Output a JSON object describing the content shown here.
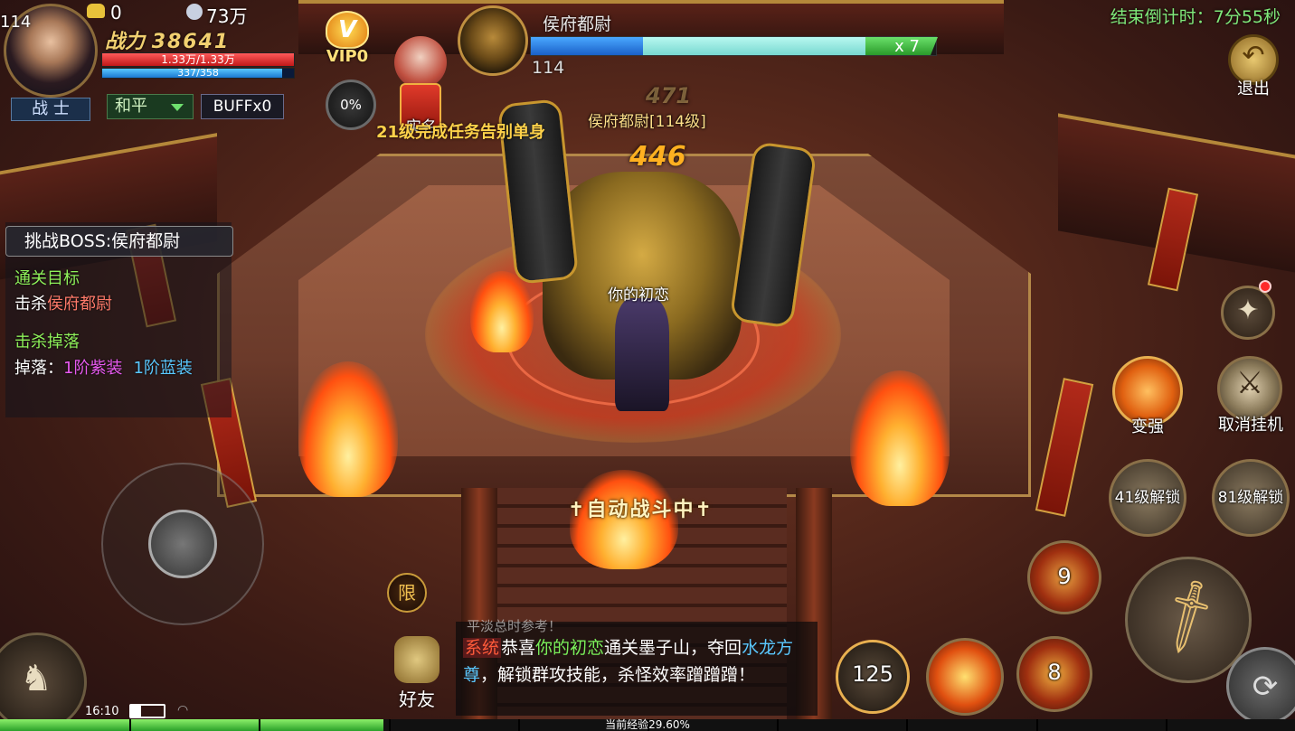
{
  "player": {
    "level": "114",
    "gold_ingot": "0",
    "silver": "73万",
    "power_label": "战力",
    "power_value": "38641",
    "hp_text": "1.33万/1.33万",
    "mp_text": "337/358",
    "class": "战 士",
    "pk_mode": "和平",
    "buff": "BUFFx0",
    "percent": "0%",
    "vip": "VIP0"
  },
  "realname": {
    "label": "实名"
  },
  "quest_marquee": "21级完成任务告别单身",
  "boss": {
    "name": "侯府都尉",
    "level": "114",
    "hp_multiplier": "x 7",
    "overhead_name": "侯府都尉[114级]",
    "damage_faded": "471",
    "damage": "446"
  },
  "hero_name": "你的初恋",
  "timer": "结束倒计时：7分55秒",
  "exit": {
    "label": "退出"
  },
  "quest_panel": {
    "title": "挑战BOSS:侯府都尉",
    "goal_header": "通关目标",
    "goal_prefix": "击杀",
    "goal_target": "侯府都尉",
    "drop_header": "击杀掉落",
    "drop_prefix": "掉落：",
    "drop_purple": "1阶紫装",
    "drop_blue": "1阶蓝装"
  },
  "auto_fight": "自动战斗中",
  "right_buttons": {
    "strengthen": "变强",
    "cancel_afk": "取消挂机",
    "unlock_41": "41级解锁",
    "unlock_81": "81级解锁",
    "skill_cd_1": "9",
    "skill_cd_2": "8",
    "skill_center": "125"
  },
  "limit_label": "限",
  "friend_label": "好友",
  "chat": {
    "faded_top": "平淡总时参考！",
    "tag": "系统",
    "before": "恭喜",
    "player": "你的初恋",
    "middle": "通关墨子山，夺回",
    "item": "水龙方尊",
    "after": "，解锁群攻技能，杀怪效率蹭蹭蹭！"
  },
  "status": {
    "time": "16:10"
  },
  "exp": {
    "label": "当前经验29.60%",
    "percent": 29.6
  },
  "colors": {
    "accent_gold": "#f2d070",
    "timer_green": "#7fe87a",
    "hp_red": "#c01818",
    "quest_green": "#8ef05a"
  }
}
